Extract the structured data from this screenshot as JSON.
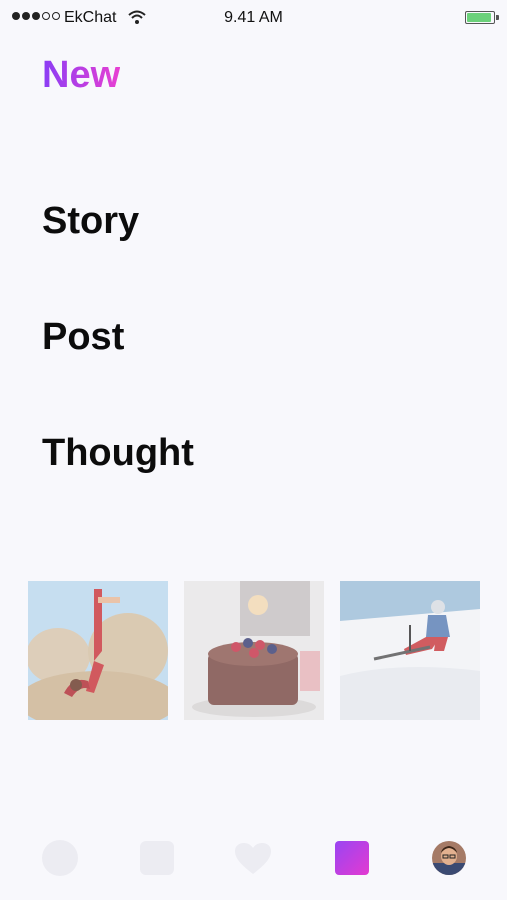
{
  "status_bar": {
    "carrier": "EkChat",
    "time": "9.41 AM",
    "battery_color": "#6bd17a"
  },
  "header": {
    "title": "New",
    "title_gradient": [
      "#8a3df5",
      "#e83fd2"
    ]
  },
  "menu": {
    "options": [
      "Story",
      "Post",
      "Thought"
    ]
  },
  "thumbnails": [
    {
      "icon": "yoga-photo"
    },
    {
      "icon": "cake-photo"
    },
    {
      "icon": "skier-photo"
    }
  ],
  "tab_bar": {
    "icons": [
      "home-icon",
      "chat-icon",
      "heart-icon",
      "new-icon",
      "profile-avatar"
    ],
    "accent": "#c23de0"
  }
}
